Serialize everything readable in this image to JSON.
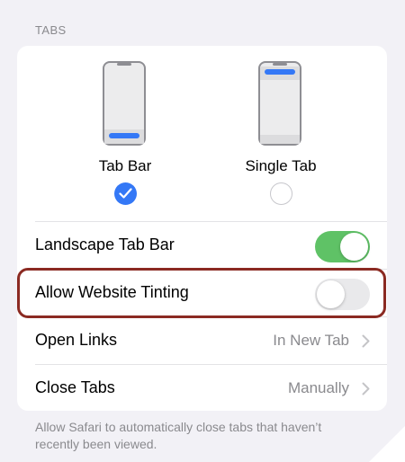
{
  "section": {
    "header": "TABS",
    "footer": "Allow Safari to automatically close tabs that haven’t recently been viewed."
  },
  "layout_options": [
    {
      "label": "Tab Bar",
      "selected": true
    },
    {
      "label": "Single Tab",
      "selected": false
    }
  ],
  "rows": {
    "landscape_tab_bar": {
      "label": "Landscape Tab Bar",
      "on": true
    },
    "allow_website_tinting": {
      "label": "Allow Website Tinting",
      "on": false
    },
    "open_links": {
      "label": "Open Links",
      "value": "In New Tab"
    },
    "close_tabs": {
      "label": "Close Tabs",
      "value": "Manually"
    }
  },
  "colors": {
    "accent": "#3478f6",
    "toggle_on": "#5fc266",
    "highlight": "#8b2a22"
  }
}
